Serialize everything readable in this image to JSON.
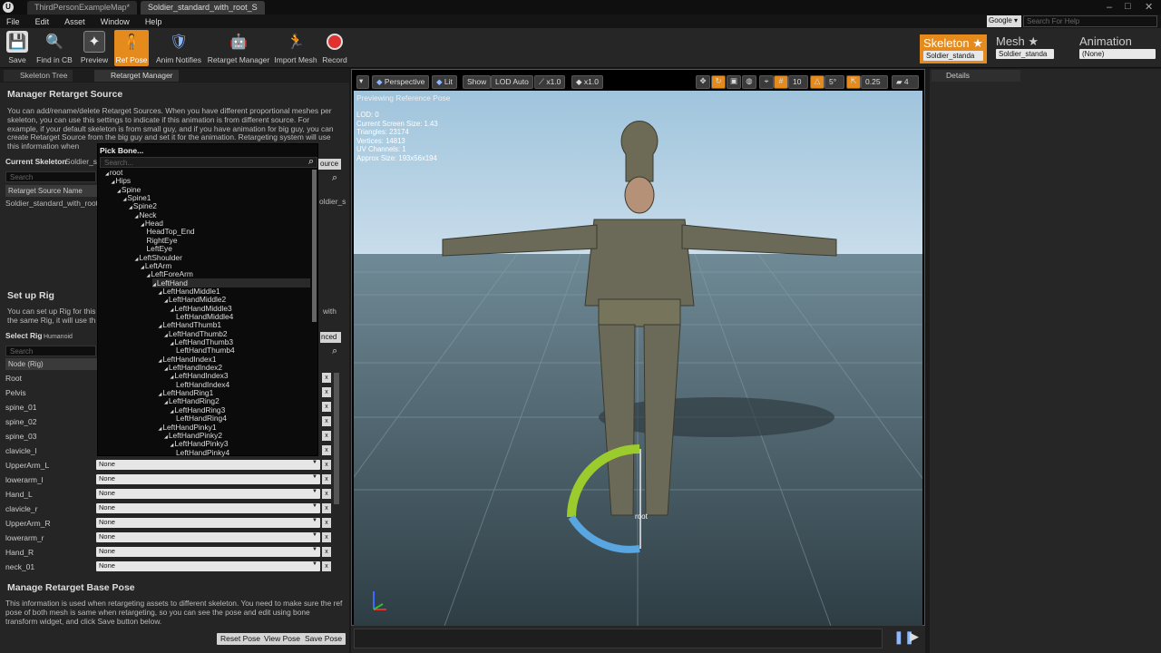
{
  "tabs": [
    {
      "label": "ThirdPersonExampleMap*"
    },
    {
      "label": "Soldier_standard_with_root_S"
    }
  ],
  "menu": [
    "File",
    "Edit",
    "Asset",
    "Window",
    "Help"
  ],
  "search": {
    "engine": "Google",
    "placeholder": "Search For Help"
  },
  "toolbar": {
    "save": "Save",
    "find_in_cb": "Find in CB",
    "preview": "Preview",
    "ref_pose": "Ref Pose",
    "anim_notifies": "Anim Notifies",
    "retarget_manager": "Retarget Manager",
    "import_mesh": "Import Mesh",
    "record": "Record"
  },
  "modes": {
    "skeleton": {
      "label": "Skeleton",
      "asset": "Soldier_standa"
    },
    "mesh": {
      "label": "Mesh",
      "asset": "Soldier_standa"
    },
    "animation": {
      "label": "Animation",
      "asset": "(None)"
    }
  },
  "panel_tabs": {
    "skeleton_tree": "Skeleton Tree",
    "retarget_manager": "Retarget Manager"
  },
  "retarget_source": {
    "title": "Manager Retarget Source",
    "description": "You can add/rename/delete Retarget Sources. When you have different proportional meshes per skeleton, you can use this settings to indicate if this animation is from different source. For example, if your default skeleton is from small guy, and if you have animation for big guy, you can create Retarget Source from the big guy and set it for the animation. Retargeting system will use this information when",
    "current_skeleton_label": "Current Skeleton",
    "current_skeleton_value": "Soldier_s",
    "add_button": "ource",
    "search_placeholder": "Search",
    "column_header": "Retarget Source Name",
    "row": "Soldier_standard_with_root",
    "row_right": "oldier_s"
  },
  "setup_rig": {
    "title": "Set up Rig",
    "description_line1": "You can set up Rig for this",
    "description_line1_tail": "with",
    "description_line2": "the same Rig, it will use th",
    "select_rig_label": "Select Rig",
    "select_rig_value": "Humanoid",
    "advanced_button": "nced",
    "search_placeholder": "Search",
    "node_header": "Node (Rig)",
    "nodes": [
      {
        "name": "Root",
        "value": ""
      },
      {
        "name": "Pelvis",
        "value": ""
      },
      {
        "name": "spine_01",
        "value": ""
      },
      {
        "name": "spine_02",
        "value": ""
      },
      {
        "name": "spine_03",
        "value": ""
      },
      {
        "name": "clavicle_l",
        "value": ""
      },
      {
        "name": "UpperArm_L",
        "value": "None"
      },
      {
        "name": "lowerarm_l",
        "value": "None"
      },
      {
        "name": "Hand_L",
        "value": "None"
      },
      {
        "name": "clavicle_r",
        "value": "None"
      },
      {
        "name": "UpperArm_R",
        "value": "None"
      },
      {
        "name": "lowerarm_r",
        "value": "None"
      },
      {
        "name": "Hand_R",
        "value": "None"
      },
      {
        "name": "neck_01",
        "value": "None"
      }
    ],
    "clear_label": "x"
  },
  "pick_bone": {
    "title": "Pick Bone...",
    "search_placeholder": "Search...",
    "bones": [
      {
        "name": "root",
        "depth": 0,
        "arrow": true
      },
      {
        "name": "Hips",
        "depth": 1,
        "arrow": true
      },
      {
        "name": "Spine",
        "depth": 2,
        "arrow": true
      },
      {
        "name": "Spine1",
        "depth": 3,
        "arrow": true
      },
      {
        "name": "Spine2",
        "depth": 4,
        "arrow": true
      },
      {
        "name": "Neck",
        "depth": 5,
        "arrow": true
      },
      {
        "name": "Head",
        "depth": 6,
        "arrow": true
      },
      {
        "name": "HeadTop_End",
        "depth": 7,
        "arrow": false
      },
      {
        "name": "RightEye",
        "depth": 7,
        "arrow": false
      },
      {
        "name": "LeftEye",
        "depth": 7,
        "arrow": false
      },
      {
        "name": "LeftShoulder",
        "depth": 5,
        "arrow": true
      },
      {
        "name": "LeftArm",
        "depth": 6,
        "arrow": true
      },
      {
        "name": "LeftForeArm",
        "depth": 7,
        "arrow": true
      },
      {
        "name": "LeftHand",
        "depth": 8,
        "arrow": true
      },
      {
        "name": "LeftHandMiddle1",
        "depth": 9,
        "arrow": true
      },
      {
        "name": "LeftHandMiddle2",
        "depth": 10,
        "arrow": true
      },
      {
        "name": "LeftHandMiddle3",
        "depth": 11,
        "arrow": true
      },
      {
        "name": "LeftHandMiddle4",
        "depth": 12,
        "arrow": false
      },
      {
        "name": "LeftHandThumb1",
        "depth": 9,
        "arrow": true
      },
      {
        "name": "LeftHandThumb2",
        "depth": 10,
        "arrow": true
      },
      {
        "name": "LeftHandThumb3",
        "depth": 11,
        "arrow": true
      },
      {
        "name": "LeftHandThumb4",
        "depth": 12,
        "arrow": false
      },
      {
        "name": "LeftHandIndex1",
        "depth": 9,
        "arrow": true
      },
      {
        "name": "LeftHandIndex2",
        "depth": 10,
        "arrow": true
      },
      {
        "name": "LeftHandIndex3",
        "depth": 11,
        "arrow": true
      },
      {
        "name": "LeftHandIndex4",
        "depth": 12,
        "arrow": false
      },
      {
        "name": "LeftHandRing1",
        "depth": 9,
        "arrow": true
      },
      {
        "name": "LeftHandRing2",
        "depth": 10,
        "arrow": true
      },
      {
        "name": "LeftHandRing3",
        "depth": 11,
        "arrow": true
      },
      {
        "name": "LeftHandRing4",
        "depth": 12,
        "arrow": false
      },
      {
        "name": "LeftHandPinky1",
        "depth": 9,
        "arrow": true
      },
      {
        "name": "LeftHandPinky2",
        "depth": 10,
        "arrow": true
      },
      {
        "name": "LeftHandPinky3",
        "depth": 11,
        "arrow": true
      },
      {
        "name": "LeftHandPinky4",
        "depth": 12,
        "arrow": false
      }
    ],
    "highlighted": "LeftHand"
  },
  "base_pose": {
    "title": "Manage Retarget Base Pose",
    "description": "This information is used when retargeting assets to different skeleton. You need to make sure the ref pose of both mesh is same when retargeting, so you can see the pose and edit using bone transform widget, and click Save button below.",
    "reset": "Reset Pose",
    "view": "View Pose",
    "save": "Save Pose"
  },
  "viewport": {
    "perspective": "Perspective",
    "lit": "Lit",
    "show": "Show",
    "lod": "LOD Auto",
    "speed1": "x1.0",
    "speed2": "x1.0",
    "grid": "10",
    "angle": "5°",
    "scale": "0.25",
    "cam": "4",
    "overlay": "Previewing Reference Pose",
    "stats": [
      "LOD: 0",
      "Current Screen Size: 1.43",
      "Triangles: 23174",
      "Vertices: 14813",
      "UV Channels: 1",
      "Approx Size: 193x56x194"
    ],
    "root_label": "root"
  },
  "details": {
    "title": "Details"
  }
}
